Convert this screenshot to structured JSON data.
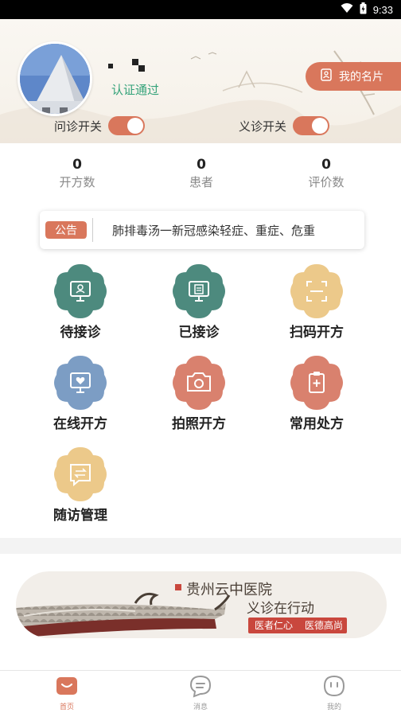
{
  "status_bar": {
    "time": "9:33"
  },
  "profile": {
    "verified_label": "认证通过",
    "card_button_label": "我的名片"
  },
  "switches": [
    {
      "label": "问诊开关",
      "on": true
    },
    {
      "label": "义诊开关",
      "on": true
    }
  ],
  "stats": [
    {
      "value": "0",
      "label": "开方数"
    },
    {
      "value": "0",
      "label": "患者"
    },
    {
      "value": "0",
      "label": "评价数"
    }
  ],
  "notice": {
    "badge": "公告",
    "text": "肺排毒汤一新冠感染轻症、重症、危重"
  },
  "menu": [
    {
      "label": "待接诊",
      "icon": "monitor-user-icon",
      "color": "#4d8a7e"
    },
    {
      "label": "已接诊",
      "icon": "monitor-doc-icon",
      "color": "#4d8a7e"
    },
    {
      "label": "扫码开方",
      "icon": "scan-icon",
      "color": "#ecc98a"
    },
    {
      "label": "在线开方",
      "icon": "monitor-heart-icon",
      "color": "#7c9dc4"
    },
    {
      "label": "拍照开方",
      "icon": "camera-icon",
      "color": "#d9816e"
    },
    {
      "label": "常用处方",
      "icon": "clipboard-plus-icon",
      "color": "#d9816e"
    },
    {
      "label": "随访管理",
      "icon": "message-icon",
      "color": "#ecc98a"
    }
  ],
  "banner": {
    "title": "贵州云中医院",
    "subtitle": "义诊在行动",
    "tags": [
      "医者仁心",
      "医德高尚"
    ]
  },
  "tabs": [
    {
      "label": "首页",
      "active": true
    },
    {
      "label": "消息",
      "active": false
    },
    {
      "label": "我的",
      "active": false
    }
  ],
  "colors": {
    "accent": "#d9775c",
    "verified": "#35a37a",
    "teal": "#4d8a7e",
    "gold": "#ecc98a",
    "blue": "#7c9dc4",
    "coral": "#d9816e"
  }
}
